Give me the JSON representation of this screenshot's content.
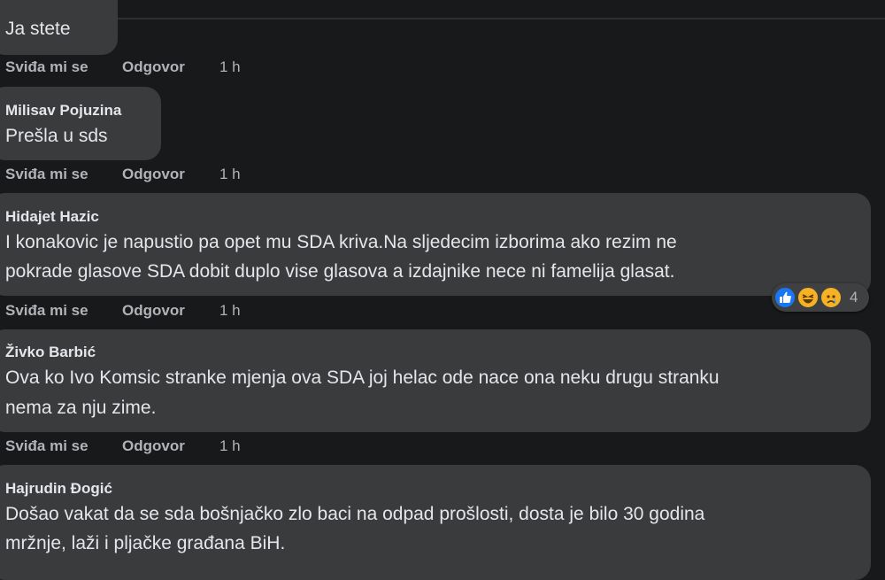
{
  "actions": {
    "like": "Sviđa mi se",
    "reply": "Odgovor"
  },
  "comments": [
    {
      "author": "",
      "lines": [
        "Ja stete"
      ],
      "time": "1 h"
    },
    {
      "author": "Milisav Pojuzina",
      "lines": [
        "Prešla u sds"
      ],
      "time": "1 h"
    },
    {
      "author": "Hidajet Hazic",
      "lines": [
        "I konakovic je napustio pa opet mu SDA kriva.Na sljedecim izborima ako rezim ne",
        "pokrade glasove SDA dobit duplo vise glasova a izdajnike nece ni famelija glasat."
      ],
      "time": "1 h",
      "reactions": {
        "count": "4",
        "types": [
          "like-icon",
          "haha-icon",
          "sad-icon"
        ]
      }
    },
    {
      "author": "Živko Barbić",
      "lines": [
        "Ova ko Ivo Komsic stranke mjenja ova SDA joj helac ode nace ona neku drugu stranku",
        "nema za nju zime."
      ],
      "time": "1 h"
    },
    {
      "author": "Hajrudin Đogić",
      "lines": [
        "Došao vakat da se sda bošnjačko zlo baci na odpad prošlosti, dosta je bilo 30 godina",
        "mržnje, laži i pljačke građana BiH."
      ],
      "time": ""
    }
  ],
  "colors": {
    "background": "#18191a",
    "bubble": "#3a3b3c",
    "text": "#e4e6eb",
    "muted": "#b0b3b8",
    "like": "#1877f2",
    "haha": "#f7b125"
  }
}
